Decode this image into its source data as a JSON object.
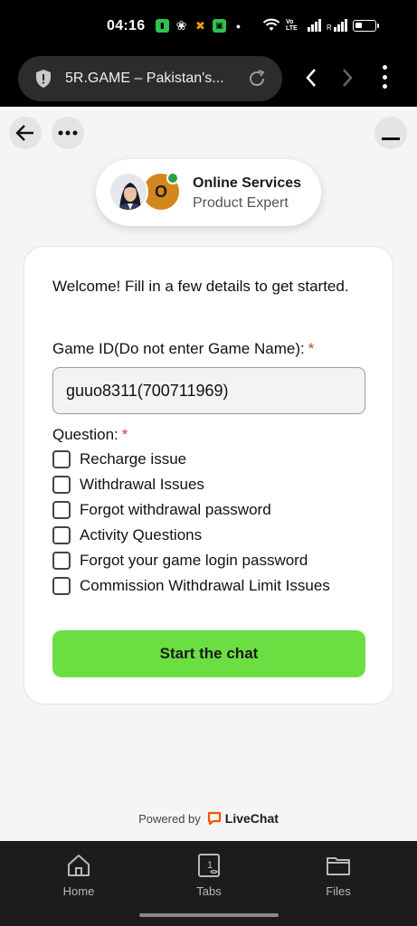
{
  "status_bar": {
    "time": "04:16",
    "network_label": "Vo LTE"
  },
  "browser": {
    "url_title": "5R.GAME – Pakistan's...",
    "icons": [
      "shield-icon",
      "reload-icon",
      "back-icon",
      "forward-icon",
      "more-menu-icon"
    ]
  },
  "chat_header": {
    "agent_name": "Online Services",
    "agent_role": "Product Expert",
    "avatar_initial": "O",
    "online_color": "#2f9e44"
  },
  "form": {
    "welcome": "Welcome! Fill in a few details to get started.",
    "game_id_label": "Game ID(Do not enter Game Name):",
    "required_mark": "*",
    "game_id_value": "guuo8311(700711969)",
    "question_label": "Question:",
    "options": [
      "Recharge issue",
      "Withdrawal Issues",
      "Forgot withdrawal password",
      "Activity Questions",
      "Forgot your game login password",
      "Commission Withdrawal Limit Issues"
    ],
    "start_button": "Start the chat",
    "button_color": "#6bdf42"
  },
  "footer": {
    "powered_by": "Powered by",
    "brand": "LiveChat",
    "brand_color": "#ff5100"
  },
  "bottom_nav": {
    "items": [
      {
        "label": "Home",
        "icon": "home-icon"
      },
      {
        "label": "Tabs",
        "icon": "tabs-icon",
        "count": "1"
      },
      {
        "label": "Files",
        "icon": "folder-icon"
      }
    ]
  }
}
